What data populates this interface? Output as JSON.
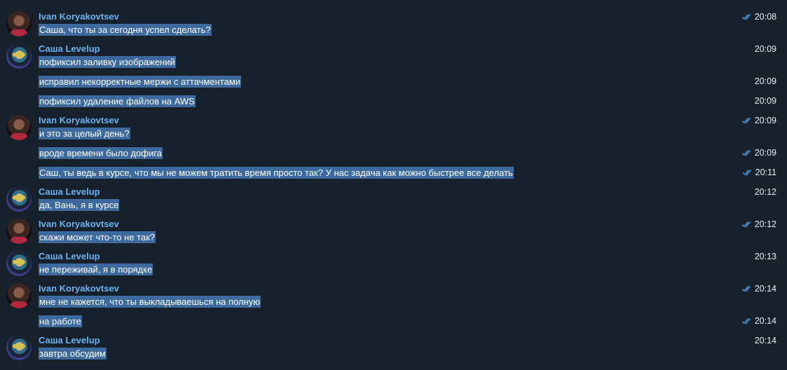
{
  "colors": {
    "background": "#17212b",
    "author_name": "#6ab3f3",
    "selection": "#3d6a9e",
    "check": "#4fa3e8",
    "text": "#ffffff"
  },
  "messages": [
    {
      "author": "Ivan Koryakovtsev",
      "avatar": "avatar-ivan",
      "text": "Саша, что ты за сегодня успел сделать?",
      "time": "20:08",
      "read": true
    },
    {
      "author": "Саша Levelup",
      "avatar": "avatar-sasha",
      "text": "пофиксил заливку изображений",
      "time": "20:09",
      "read": false
    },
    {
      "author": "",
      "text": "исправил некорректные мержи с аттачментами",
      "time": "20:09",
      "read": false
    },
    {
      "author": "",
      "text": "пофиксил удаление файлов на AWS",
      "time": "20:09",
      "read": false
    },
    {
      "author": "Ivan Koryakovtsev",
      "avatar": "avatar-ivan",
      "text": "и это за целый день?",
      "time": "20:09",
      "read": true
    },
    {
      "author": "",
      "text": "вроде времени было дофига",
      "time": "20:09",
      "read": true
    },
    {
      "author": "",
      "text": "Саш, ты ведь в курсе, что мы не можем тратить время просто так? У нас задача как можно быстрее все делать",
      "time": "20:11",
      "read": true
    },
    {
      "author": "Саша Levelup",
      "avatar": "avatar-sasha",
      "text": "да, Вань, я в курсе",
      "time": "20:12",
      "read": false
    },
    {
      "author": "Ivan Koryakovtsev",
      "avatar": "avatar-ivan",
      "text": "скажи может что-то не так?",
      "time": "20:12",
      "read": true
    },
    {
      "author": "Саша Levelup",
      "avatar": "avatar-sasha",
      "text": "не переживай, я в порядке",
      "time": "20:13",
      "read": false
    },
    {
      "author": "Ivan Koryakovtsev",
      "avatar": "avatar-ivan",
      "text": "мне не кажется, что ты выкладываешься на полную",
      "time": "20:14",
      "read": true
    },
    {
      "author": "",
      "text": "на работе",
      "time": "20:14",
      "read": true
    },
    {
      "author": "Саша Levelup",
      "avatar": "avatar-sasha",
      "text": "завтра обсудим",
      "time": "20:14",
      "read": false
    }
  ]
}
